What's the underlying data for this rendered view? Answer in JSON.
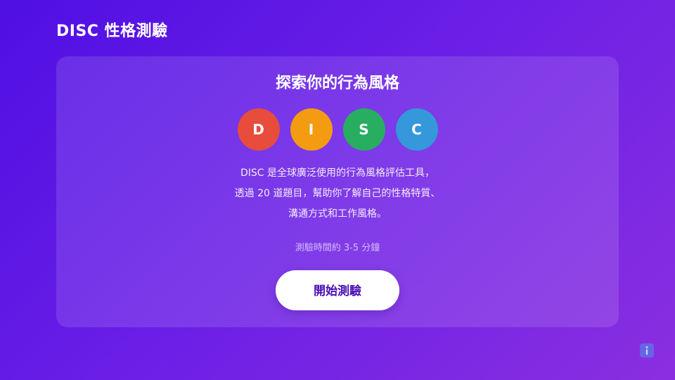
{
  "header": {
    "title": "DISC 性格測驗"
  },
  "card": {
    "title": "探索你的行為風格",
    "disc": [
      {
        "letter": "D",
        "color": "#e74c3c"
      },
      {
        "letter": "I",
        "color": "#f39c12"
      },
      {
        "letter": "S",
        "color": "#27ae60"
      },
      {
        "letter": "C",
        "color": "#3498db"
      }
    ],
    "description": [
      "DISC 是全球廣泛使用的行為風格評估工具，",
      "透過 20 道題目，幫助你了解自己的性格特質、",
      "溝通方式和工作風格。"
    ],
    "duration": "測驗時間約 3-5 分鐘",
    "start_label": "開始測驗"
  },
  "info_button": {
    "icon": "info-icon",
    "color": "#5a78e6"
  }
}
